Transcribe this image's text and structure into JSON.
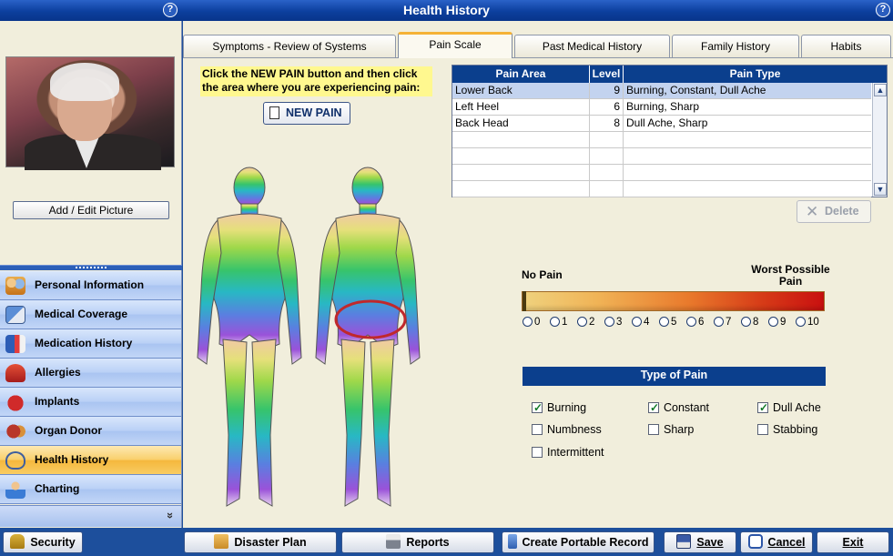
{
  "window": {
    "title": "Health History"
  },
  "left_panel": {
    "add_picture_label": "Add / Edit Picture",
    "nav": [
      {
        "label": "Personal Information",
        "icon": "people-icon"
      },
      {
        "label": "Medical Coverage",
        "icon": "insurance-card-icon"
      },
      {
        "label": "Medication History",
        "icon": "pill-bottle-icon"
      },
      {
        "label": "Allergies",
        "icon": "allergy-icon"
      },
      {
        "label": "Implants",
        "icon": "heart-device-icon"
      },
      {
        "label": "Organ Donor",
        "icon": "organ-icon"
      },
      {
        "label": "Health History",
        "icon": "stethoscope-icon",
        "active": true
      },
      {
        "label": "Charting",
        "icon": "doctor-icon"
      }
    ],
    "more_glyph": "»"
  },
  "tabs": [
    {
      "label": "Symptoms - Review of Systems"
    },
    {
      "label": "Pain Scale",
      "active": true
    },
    {
      "label": "Past Medical History"
    },
    {
      "label": "Family History"
    },
    {
      "label": "Habits"
    }
  ],
  "pain_scale": {
    "instruction": "Click the NEW PAIN button and then click the area where you are experiencing pain:",
    "new_pain_label": "NEW PAIN",
    "table": {
      "headers": [
        "Pain Area",
        "Level",
        "Pain Type"
      ],
      "rows": [
        {
          "area": "Lower Back",
          "level": "9",
          "type": "Burning, Constant, Dull Ache",
          "selected": true
        },
        {
          "area": "Left Heel",
          "level": "6",
          "type": "Burning, Sharp"
        },
        {
          "area": "Back Head",
          "level": "8",
          "type": "Dull Ache, Sharp"
        }
      ],
      "empty_rows": 4
    },
    "delete_label": "Delete",
    "scale": {
      "no_pain_label": "No Pain",
      "worst_label": "Worst Possible Pain",
      "levels": [
        "0",
        "1",
        "2",
        "3",
        "4",
        "5",
        "6",
        "7",
        "8",
        "9",
        "10"
      ],
      "gradient_colors": [
        "#efd27e",
        "#e97a2c",
        "#c91010"
      ]
    },
    "type_of_pain": {
      "header": "Type of Pain",
      "options": [
        {
          "label": "Burning",
          "checked": true
        },
        {
          "label": "Constant",
          "checked": true
        },
        {
          "label": "Dull Ache",
          "checked": true
        },
        {
          "label": "Numbness",
          "checked": false
        },
        {
          "label": "Sharp",
          "checked": false
        },
        {
          "label": "Stabbing",
          "checked": false
        },
        {
          "label": "Intermittent",
          "checked": false
        }
      ]
    }
  },
  "bottom_bar": {
    "security": "Security",
    "disaster_plan": "Disaster Plan",
    "reports": "Reports",
    "portable": "Create Portable Record",
    "save": "Save",
    "cancel": "Cancel",
    "exit": "Exit"
  },
  "colors": {
    "header_blue": "#0b3f8d",
    "panel_bg": "#f1eedc",
    "selected_row": "#c3d3ef",
    "instruction_bg": "#fff88f",
    "active_nav": "#f9cf6a",
    "pain_marker": "#c0282c"
  }
}
